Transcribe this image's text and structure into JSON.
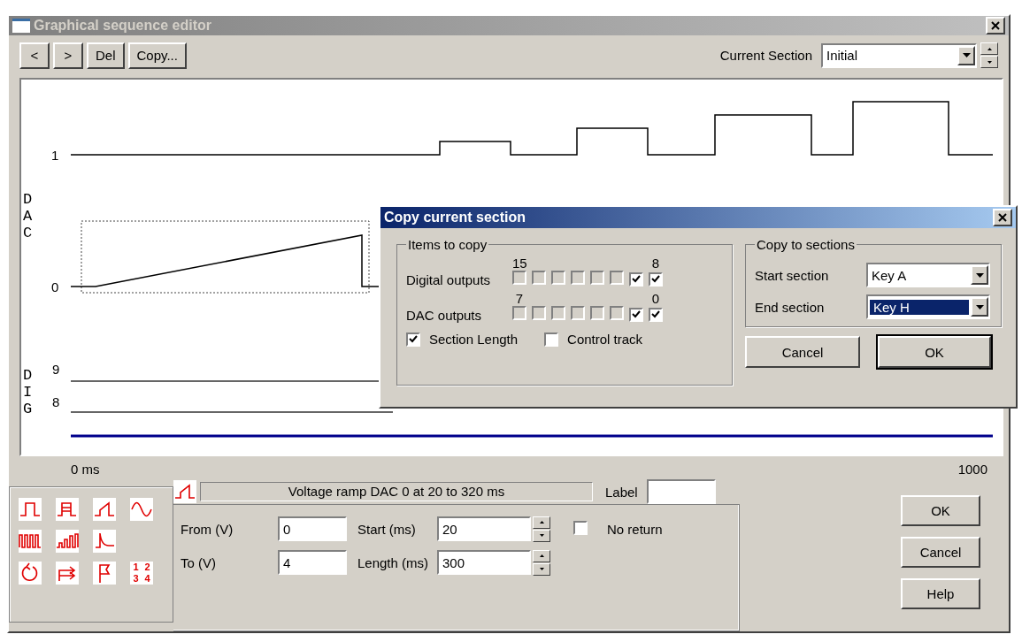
{
  "window": {
    "title": "Graphical sequence editor"
  },
  "toolbar": {
    "buttons": [
      "<",
      ">",
      "Del",
      "Copy..."
    ],
    "section_label": "Current Section",
    "section_value": "Initial"
  },
  "graph": {
    "top_level": "1",
    "dac_label": "DAC",
    "dac_level": "0",
    "dig_label": "DIG",
    "dig_channels": [
      "9",
      "8"
    ],
    "x_start": "0 ms",
    "x_end": "1000"
  },
  "tools": {
    "numbering_digits": [
      "1",
      "2",
      "3",
      "4"
    ]
  },
  "event": {
    "description": "Voltage ramp DAC 0 at 20 to 320 ms",
    "label_caption": "Label",
    "values": [
      {
        "label": "From (V)",
        "value": "0"
      },
      {
        "label": "To (V)",
        "value": "4"
      }
    ],
    "timing": [
      {
        "label": "Start (ms)",
        "value": "20"
      },
      {
        "label": "Length (ms)",
        "value": "300"
      }
    ],
    "no_return": {
      "label": "No return",
      "checked": false
    }
  },
  "buttons": [
    "OK",
    "Cancel",
    "Help"
  ],
  "dialog": {
    "title": "Copy current section",
    "items_group": "Items to copy",
    "rows": [
      {
        "label": "Digital outputs",
        "high": "15",
        "low": "8",
        "checks": [
          {
            "checked": false,
            "disabled": true
          },
          {
            "checked": false,
            "disabled": true
          },
          {
            "checked": false,
            "disabled": true
          },
          {
            "checked": false,
            "disabled": true
          },
          {
            "checked": false,
            "disabled": true
          },
          {
            "checked": false,
            "disabled": true
          },
          {
            "checked": true,
            "disabled": false
          },
          {
            "checked": true,
            "disabled": false
          }
        ]
      },
      {
        "label": "DAC outputs",
        "high": "7",
        "low": "0",
        "checks": [
          {
            "checked": false,
            "disabled": true
          },
          {
            "checked": false,
            "disabled": true
          },
          {
            "checked": false,
            "disabled": true
          },
          {
            "checked": false,
            "disabled": true
          },
          {
            "checked": false,
            "disabled": true
          },
          {
            "checked": false,
            "disabled": true
          },
          {
            "checked": true,
            "disabled": false
          },
          {
            "checked": true,
            "disabled": false
          }
        ]
      }
    ],
    "options": [
      {
        "label": "Section Length",
        "checked": true
      },
      {
        "label": "Control track",
        "checked": false
      }
    ],
    "sections_group": "Copy to sections",
    "sections": [
      {
        "label": "Start section",
        "value": "Key A",
        "selected": false
      },
      {
        "label": "End section",
        "value": "Key H",
        "selected": true
      }
    ],
    "buttons": [
      {
        "label": "Cancel",
        "default": false
      },
      {
        "label": "OK",
        "default": true
      }
    ]
  }
}
